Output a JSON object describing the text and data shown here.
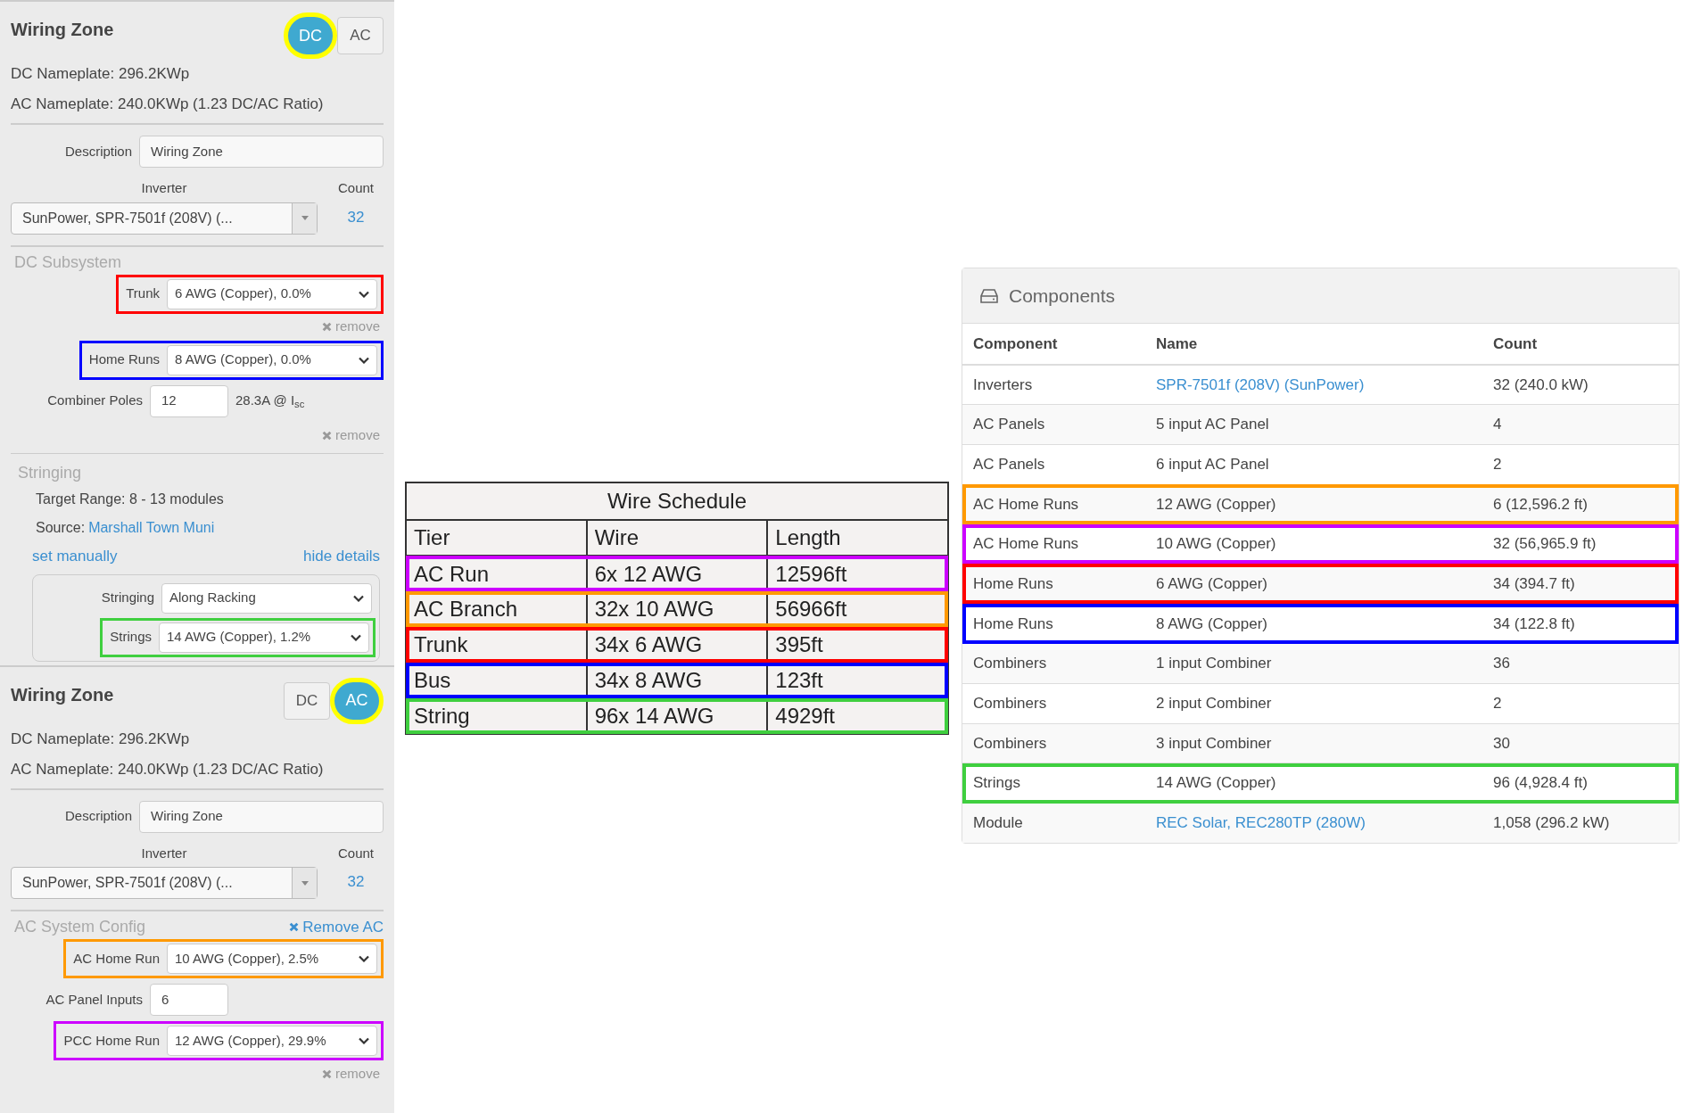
{
  "zones": [
    {
      "title": "Wiring Zone",
      "toggle": [
        {
          "label": "DC",
          "selected": true
        },
        {
          "label": "AC",
          "selected": false
        }
      ],
      "lines": [
        "DC Nameplate: 296.2KWp",
        "AC Nameplate: 240.0KWp (1.23 DC/AC Ratio)"
      ],
      "description": {
        "label": "Description",
        "value": "Wiring Zone"
      },
      "inverter": {
        "label": "Inverter",
        "value": "SunPower, SPR-7501f (208V) (..."
      },
      "count": {
        "label": "Count",
        "value": "32"
      },
      "section": {
        "title": "DC Subsystem",
        "rows": [
          {
            "kind": "select",
            "label": "Trunk",
            "value": "6 AWG (Copper), 0.0%",
            "color": "#ff0000"
          },
          {
            "kind": "remove",
            "label": "remove"
          },
          {
            "kind": "select",
            "label": "Home Runs",
            "value": "8 AWG (Copper), 0.0%",
            "color": "#0000ff"
          },
          {
            "kind": "input",
            "label": "Combiner Poles",
            "value": "12",
            "note": "28.3A @ I$_{sc}$"
          },
          {
            "kind": "remove",
            "label": "remove"
          },
          {
            "kind": "heading",
            "text": "Stringing"
          },
          {
            "kind": "text",
            "text": "Target Range: 8 - 13 modules"
          },
          {
            "kind": "source",
            "label": "Source:",
            "link": "Marshall Town Muni"
          },
          {
            "kind": "links",
            "left": "set manually",
            "right": "hide details"
          },
          {
            "kind": "group",
            "rows": [
              {
                "kind": "select",
                "label": "Stringing",
                "value": "Along Racking"
              },
              {
                "kind": "select",
                "label": "Strings",
                "value": "14 AWG (Copper), 1.2%",
                "color": "#3fcf3f"
              }
            ]
          }
        ]
      }
    },
    {
      "title": "Wiring Zone",
      "toggle": [
        {
          "label": "DC",
          "selected": false
        },
        {
          "label": "AC",
          "selected": true
        }
      ],
      "lines": [
        "DC Nameplate: 296.2KWp",
        "AC Nameplate: 240.0KWp (1.23 DC/AC Ratio)"
      ],
      "description": {
        "label": "Description",
        "value": "Wiring Zone"
      },
      "inverter": {
        "label": "Inverter",
        "value": "SunPower, SPR-7501f (208V) (..."
      },
      "count": {
        "label": "Count",
        "value": "32"
      },
      "section": {
        "title": "AC System Config",
        "action": "Remove AC",
        "rows": [
          {
            "kind": "select",
            "label": "AC Home Run",
            "value": "10 AWG (Copper), 2.5%",
            "color": "#ff9900"
          },
          {
            "kind": "input",
            "label": "AC Panel Inputs",
            "value": "6"
          },
          {
            "kind": "select",
            "label": "PCC Home Run",
            "value": "12 AWG (Copper), 29.9%",
            "color": "#cc00ff"
          },
          {
            "kind": "remove",
            "label": "remove"
          }
        ]
      }
    }
  ],
  "wire_schedule": {
    "title": "Wire Schedule",
    "columns": [
      "Tier",
      "Wire",
      "Length"
    ],
    "rows": [
      {
        "cells": [
          "AC Run",
          "6x 12 AWG",
          "12596ft"
        ],
        "color": "#cc00ff"
      },
      {
        "cells": [
          "AC Branch",
          "32x 10 AWG",
          "56966ft"
        ],
        "color": "#ff9900"
      },
      {
        "cells": [
          "Trunk",
          "34x 6 AWG",
          "395ft"
        ],
        "color": "#ff0000"
      },
      {
        "cells": [
          "Bus",
          "34x 8 AWG",
          "123ft"
        ],
        "color": "#0000ff"
      },
      {
        "cells": [
          "String",
          "96x 14 AWG",
          "4929ft"
        ],
        "color": "#3fcf3f"
      }
    ]
  },
  "components": {
    "title": "Components",
    "columns": [
      "Component",
      "Name",
      "Count"
    ],
    "rows": [
      {
        "cells": [
          "Inverters",
          "SPR-7501f (208V) (SunPower)",
          "32 (240.0 kW)"
        ],
        "link": true
      },
      {
        "cells": [
          "AC Panels",
          "5 input AC Panel",
          "4"
        ],
        "link": false
      },
      {
        "cells": [
          "AC Panels",
          "6 input AC Panel",
          "2"
        ],
        "link": false
      },
      {
        "cells": [
          "AC Home Runs",
          "12 AWG (Copper)",
          "6 (12,596.2 ft)"
        ],
        "link": false,
        "color": "#ff9900"
      },
      {
        "cells": [
          "AC Home Runs",
          "10 AWG (Copper)",
          "32 (56,965.9 ft)"
        ],
        "link": false,
        "color": "#cc00ff"
      },
      {
        "cells": [
          "Home Runs",
          "6 AWG (Copper)",
          "34 (394.7 ft)"
        ],
        "link": false,
        "color": "#ff0000"
      },
      {
        "cells": [
          "Home Runs",
          "8 AWG (Copper)",
          "34 (122.8 ft)"
        ],
        "link": false,
        "color": "#0000ff"
      },
      {
        "cells": [
          "Combiners",
          "1 input Combiner",
          "36"
        ],
        "link": false
      },
      {
        "cells": [
          "Combiners",
          "2 input Combiner",
          "2"
        ],
        "link": false
      },
      {
        "cells": [
          "Combiners",
          "3 input Combiner",
          "30"
        ],
        "link": false
      },
      {
        "cells": [
          "Strings",
          "14 AWG (Copper)",
          "96 (4,928.4 ft)"
        ],
        "link": false,
        "color": "#3fcf3f"
      },
      {
        "cells": [
          "Module",
          "REC Solar, REC280TP (280W)",
          "1,058 (296.2 kW)"
        ],
        "link": true
      }
    ]
  }
}
